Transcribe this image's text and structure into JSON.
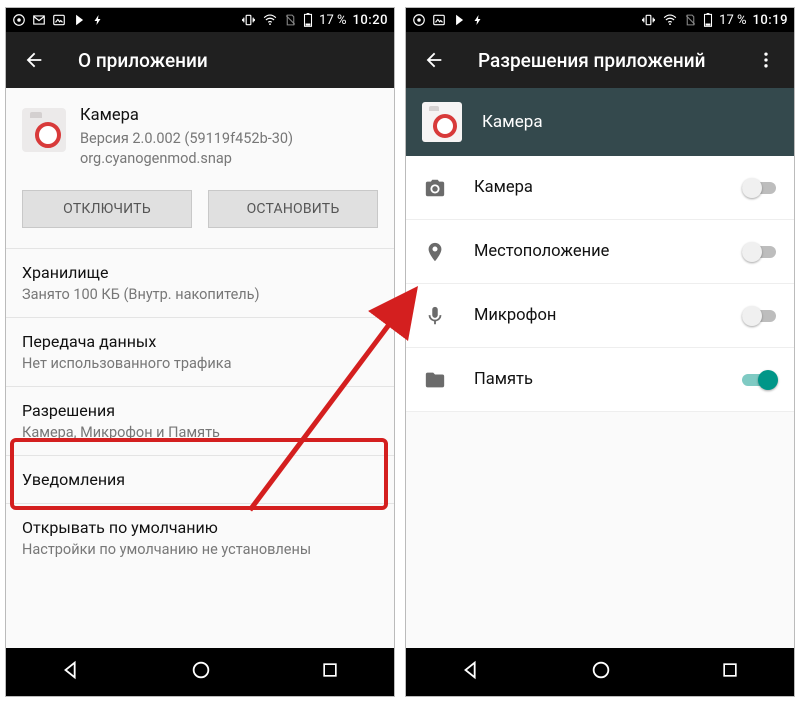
{
  "left": {
    "status": {
      "battery_text": "17 %",
      "time": "10:20"
    },
    "appbar": {
      "title": "О приложении"
    },
    "app": {
      "name": "Камера",
      "version_line": "Версия 2.0.002 (59119f452b-30)",
      "package": "org.cyanogenmod.snap"
    },
    "buttons": {
      "disable": "ОТКЛЮЧИТЬ",
      "stop": "ОСТАНОВИТЬ"
    },
    "items": {
      "storage": {
        "title": "Хранилище",
        "subtitle": "Занято 100 КБ (Внутр. накопитель)"
      },
      "data": {
        "title": "Передача данных",
        "subtitle": "Нет использованного трафика"
      },
      "permissions": {
        "title": "Разрешения",
        "subtitle": "Камера, Микрофон и Память"
      },
      "notifs": {
        "title": "Уведомления"
      },
      "defaults": {
        "title": "Открывать по умолчанию",
        "subtitle": "Настройки по умолчанию не установлены"
      }
    }
  },
  "right": {
    "status": {
      "battery_text": "17 %",
      "time": "10:19"
    },
    "appbar": {
      "title": "Разрешения приложений"
    },
    "header_app": "Камера",
    "perms": [
      {
        "icon": "camera",
        "label": "Камера",
        "on": false
      },
      {
        "icon": "location",
        "label": "Местоположение",
        "on": false
      },
      {
        "icon": "mic",
        "label": "Микрофон",
        "on": false
      },
      {
        "icon": "storage",
        "label": "Память",
        "on": true
      }
    ]
  }
}
